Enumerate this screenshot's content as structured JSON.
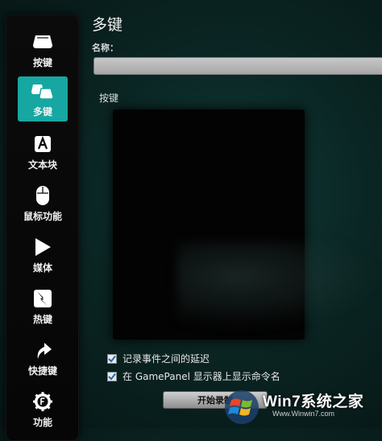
{
  "page": {
    "title": "多键",
    "name_label": "名称：",
    "name_value": "",
    "keys_label": "按键",
    "options": [
      {
        "label": "记录事件之间的延迟",
        "checked": true
      },
      {
        "label": "在 GamePanel 显示器上显示命令名",
        "checked": true
      }
    ],
    "start_button": "开始录制"
  },
  "sidebar": {
    "items": [
      {
        "label": "按键",
        "icon": "key-icon",
        "active": false
      },
      {
        "label": "多键",
        "icon": "multikey-icon",
        "active": true
      },
      {
        "label": "文本块",
        "icon": "text-block-icon",
        "active": false
      },
      {
        "label": "鼠标功能",
        "icon": "mouse-icon",
        "active": false
      },
      {
        "label": "媒体",
        "icon": "play-icon",
        "active": false
      },
      {
        "label": "热键",
        "icon": "hotkey-icon",
        "active": false
      },
      {
        "label": "快捷键",
        "icon": "shortcut-arrow-icon",
        "active": false
      },
      {
        "label": "功能",
        "icon": "function-icon",
        "active": false
      }
    ],
    "accent": "#16a7a2"
  },
  "watermark": {
    "text": "Win7系统之家",
    "url": "Www.Winwin7.com"
  }
}
